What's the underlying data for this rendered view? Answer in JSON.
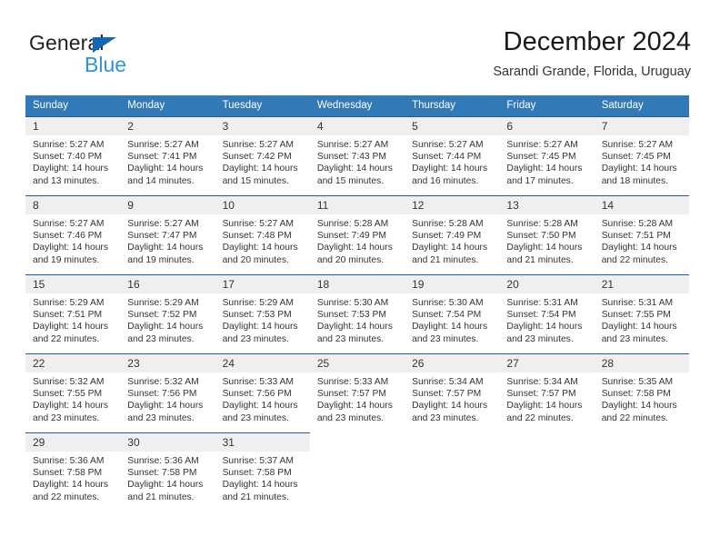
{
  "brand": {
    "name_part1": "General",
    "name_part2": "Blue",
    "triangle_color": "#1268b3",
    "blue_color": "#2e93d6"
  },
  "header": {
    "title": "December 2024",
    "subtitle": "Sarandi Grande, Florida, Uruguay"
  },
  "theme": {
    "header_bg": "#3279b7",
    "row_border": "#1f5c99",
    "daynum_bg": "#efefef"
  },
  "weekday_headers": [
    "Sunday",
    "Monday",
    "Tuesday",
    "Wednesday",
    "Thursday",
    "Friday",
    "Saturday"
  ],
  "weeks": [
    [
      {
        "day": "1",
        "sunrise": "Sunrise: 5:27 AM",
        "sunset": "Sunset: 7:40 PM",
        "daylight1": "Daylight: 14 hours",
        "daylight2": "and 13 minutes."
      },
      {
        "day": "2",
        "sunrise": "Sunrise: 5:27 AM",
        "sunset": "Sunset: 7:41 PM",
        "daylight1": "Daylight: 14 hours",
        "daylight2": "and 14 minutes."
      },
      {
        "day": "3",
        "sunrise": "Sunrise: 5:27 AM",
        "sunset": "Sunset: 7:42 PM",
        "daylight1": "Daylight: 14 hours",
        "daylight2": "and 15 minutes."
      },
      {
        "day": "4",
        "sunrise": "Sunrise: 5:27 AM",
        "sunset": "Sunset: 7:43 PM",
        "daylight1": "Daylight: 14 hours",
        "daylight2": "and 15 minutes."
      },
      {
        "day": "5",
        "sunrise": "Sunrise: 5:27 AM",
        "sunset": "Sunset: 7:44 PM",
        "daylight1": "Daylight: 14 hours",
        "daylight2": "and 16 minutes."
      },
      {
        "day": "6",
        "sunrise": "Sunrise: 5:27 AM",
        "sunset": "Sunset: 7:45 PM",
        "daylight1": "Daylight: 14 hours",
        "daylight2": "and 17 minutes."
      },
      {
        "day": "7",
        "sunrise": "Sunrise: 5:27 AM",
        "sunset": "Sunset: 7:45 PM",
        "daylight1": "Daylight: 14 hours",
        "daylight2": "and 18 minutes."
      }
    ],
    [
      {
        "day": "8",
        "sunrise": "Sunrise: 5:27 AM",
        "sunset": "Sunset: 7:46 PM",
        "daylight1": "Daylight: 14 hours",
        "daylight2": "and 19 minutes."
      },
      {
        "day": "9",
        "sunrise": "Sunrise: 5:27 AM",
        "sunset": "Sunset: 7:47 PM",
        "daylight1": "Daylight: 14 hours",
        "daylight2": "and 19 minutes."
      },
      {
        "day": "10",
        "sunrise": "Sunrise: 5:27 AM",
        "sunset": "Sunset: 7:48 PM",
        "daylight1": "Daylight: 14 hours",
        "daylight2": "and 20 minutes."
      },
      {
        "day": "11",
        "sunrise": "Sunrise: 5:28 AM",
        "sunset": "Sunset: 7:49 PM",
        "daylight1": "Daylight: 14 hours",
        "daylight2": "and 20 minutes."
      },
      {
        "day": "12",
        "sunrise": "Sunrise: 5:28 AM",
        "sunset": "Sunset: 7:49 PM",
        "daylight1": "Daylight: 14 hours",
        "daylight2": "and 21 minutes."
      },
      {
        "day": "13",
        "sunrise": "Sunrise: 5:28 AM",
        "sunset": "Sunset: 7:50 PM",
        "daylight1": "Daylight: 14 hours",
        "daylight2": "and 21 minutes."
      },
      {
        "day": "14",
        "sunrise": "Sunrise: 5:28 AM",
        "sunset": "Sunset: 7:51 PM",
        "daylight1": "Daylight: 14 hours",
        "daylight2": "and 22 minutes."
      }
    ],
    [
      {
        "day": "15",
        "sunrise": "Sunrise: 5:29 AM",
        "sunset": "Sunset: 7:51 PM",
        "daylight1": "Daylight: 14 hours",
        "daylight2": "and 22 minutes."
      },
      {
        "day": "16",
        "sunrise": "Sunrise: 5:29 AM",
        "sunset": "Sunset: 7:52 PM",
        "daylight1": "Daylight: 14 hours",
        "daylight2": "and 23 minutes."
      },
      {
        "day": "17",
        "sunrise": "Sunrise: 5:29 AM",
        "sunset": "Sunset: 7:53 PM",
        "daylight1": "Daylight: 14 hours",
        "daylight2": "and 23 minutes."
      },
      {
        "day": "18",
        "sunrise": "Sunrise: 5:30 AM",
        "sunset": "Sunset: 7:53 PM",
        "daylight1": "Daylight: 14 hours",
        "daylight2": "and 23 minutes."
      },
      {
        "day": "19",
        "sunrise": "Sunrise: 5:30 AM",
        "sunset": "Sunset: 7:54 PM",
        "daylight1": "Daylight: 14 hours",
        "daylight2": "and 23 minutes."
      },
      {
        "day": "20",
        "sunrise": "Sunrise: 5:31 AM",
        "sunset": "Sunset: 7:54 PM",
        "daylight1": "Daylight: 14 hours",
        "daylight2": "and 23 minutes."
      },
      {
        "day": "21",
        "sunrise": "Sunrise: 5:31 AM",
        "sunset": "Sunset: 7:55 PM",
        "daylight1": "Daylight: 14 hours",
        "daylight2": "and 23 minutes."
      }
    ],
    [
      {
        "day": "22",
        "sunrise": "Sunrise: 5:32 AM",
        "sunset": "Sunset: 7:55 PM",
        "daylight1": "Daylight: 14 hours",
        "daylight2": "and 23 minutes."
      },
      {
        "day": "23",
        "sunrise": "Sunrise: 5:32 AM",
        "sunset": "Sunset: 7:56 PM",
        "daylight1": "Daylight: 14 hours",
        "daylight2": "and 23 minutes."
      },
      {
        "day": "24",
        "sunrise": "Sunrise: 5:33 AM",
        "sunset": "Sunset: 7:56 PM",
        "daylight1": "Daylight: 14 hours",
        "daylight2": "and 23 minutes."
      },
      {
        "day": "25",
        "sunrise": "Sunrise: 5:33 AM",
        "sunset": "Sunset: 7:57 PM",
        "daylight1": "Daylight: 14 hours",
        "daylight2": "and 23 minutes."
      },
      {
        "day": "26",
        "sunrise": "Sunrise: 5:34 AM",
        "sunset": "Sunset: 7:57 PM",
        "daylight1": "Daylight: 14 hours",
        "daylight2": "and 23 minutes."
      },
      {
        "day": "27",
        "sunrise": "Sunrise: 5:34 AM",
        "sunset": "Sunset: 7:57 PM",
        "daylight1": "Daylight: 14 hours",
        "daylight2": "and 22 minutes."
      },
      {
        "day": "28",
        "sunrise": "Sunrise: 5:35 AM",
        "sunset": "Sunset: 7:58 PM",
        "daylight1": "Daylight: 14 hours",
        "daylight2": "and 22 minutes."
      }
    ],
    [
      {
        "day": "29",
        "sunrise": "Sunrise: 5:36 AM",
        "sunset": "Sunset: 7:58 PM",
        "daylight1": "Daylight: 14 hours",
        "daylight2": "and 22 minutes."
      },
      {
        "day": "30",
        "sunrise": "Sunrise: 5:36 AM",
        "sunset": "Sunset: 7:58 PM",
        "daylight1": "Daylight: 14 hours",
        "daylight2": "and 21 minutes."
      },
      {
        "day": "31",
        "sunrise": "Sunrise: 5:37 AM",
        "sunset": "Sunset: 7:58 PM",
        "daylight1": "Daylight: 14 hours",
        "daylight2": "and 21 minutes."
      },
      {
        "day": "",
        "sunrise": "",
        "sunset": "",
        "daylight1": "",
        "daylight2": ""
      },
      {
        "day": "",
        "sunrise": "",
        "sunset": "",
        "daylight1": "",
        "daylight2": ""
      },
      {
        "day": "",
        "sunrise": "",
        "sunset": "",
        "daylight1": "",
        "daylight2": ""
      },
      {
        "day": "",
        "sunrise": "",
        "sunset": "",
        "daylight1": "",
        "daylight2": ""
      }
    ]
  ]
}
